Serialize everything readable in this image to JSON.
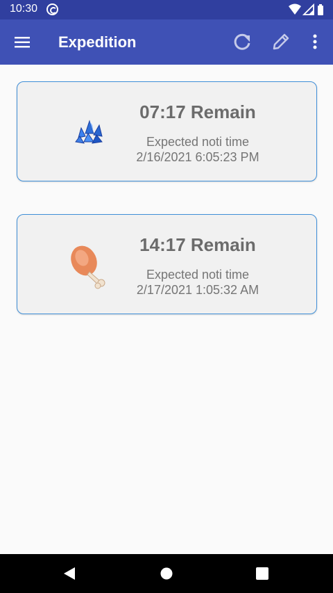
{
  "status_bar": {
    "time": "10:30",
    "icons": [
      "notification-icon",
      "wifi-icon",
      "signal-icon",
      "battery-icon"
    ]
  },
  "app_bar": {
    "title": "Expedition",
    "background_color": "#3f51b5",
    "status_color": "#303f9f",
    "actions": [
      "menu-icon",
      "refresh-icon",
      "edit-icon",
      "more-vert-icon"
    ]
  },
  "cards": [
    {
      "icon": "blue-crystal-icon",
      "remain": "07:17 Remain",
      "label": "Expected noti time",
      "time": "2/16/2021 6:05:23 PM"
    },
    {
      "icon": "meat-drumstick-icon",
      "remain": "14:17 Remain",
      "label": "Expected noti time",
      "time": "2/17/2021 1:05:32 AM"
    }
  ],
  "card_border_color": "#3f8fd8",
  "nav_bar": {
    "buttons": [
      "back-icon",
      "home-icon",
      "recents-icon"
    ]
  }
}
